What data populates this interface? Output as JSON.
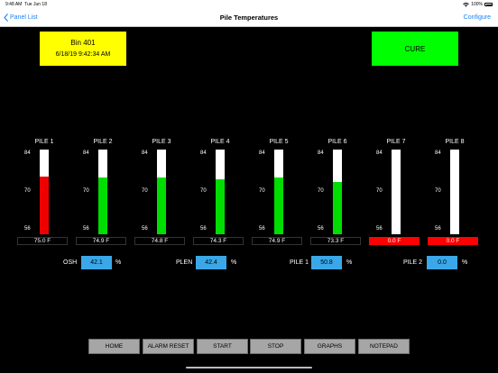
{
  "status_bar": {
    "time": "9:48 AM",
    "date": "Tue Jun 18",
    "battery": "100%"
  },
  "nav": {
    "back_label": "Panel List",
    "title": "Pile Temperatures",
    "configure_label": "Configure"
  },
  "bin": {
    "name": "Bin 401",
    "datetime": "6/18/19  9:42:34 AM"
  },
  "mode_label": "CURE",
  "colors": {
    "bin_box": "#ffff00",
    "mode_box": "#00ff00",
    "alarm": "#ff0000",
    "normal_fill": "#00dd00",
    "param_box": "#3aa8e8"
  },
  "scale": {
    "min": 56,
    "max": 84,
    "ticks": [
      "84",
      "70",
      "56"
    ]
  },
  "piles": [
    {
      "label": "PILE 1",
      "reading": "75.0 F",
      "level": 75.0,
      "alarm": false,
      "fill_color": "#ee0000"
    },
    {
      "label": "PILE 2",
      "reading": "74.9 F",
      "level": 74.9,
      "alarm": false,
      "fill_color": "#00dd00"
    },
    {
      "label": "PILE 3",
      "reading": "74.8 F",
      "level": 74.8,
      "alarm": false,
      "fill_color": "#00dd00"
    },
    {
      "label": "PILE 4",
      "reading": "74.3 F",
      "level": 74.3,
      "alarm": false,
      "fill_color": "#00dd00"
    },
    {
      "label": "PILE 5",
      "reading": "74.9 F",
      "level": 74.9,
      "alarm": false,
      "fill_color": "#00dd00"
    },
    {
      "label": "PILE 6",
      "reading": "73.3 F",
      "level": 73.3,
      "alarm": false,
      "fill_color": "#00dd00"
    },
    {
      "label": "PILE 7",
      "reading": "0.0 F",
      "level": 0.0,
      "alarm": true,
      "fill_color": "#00dd00"
    },
    {
      "label": "PILE 8",
      "reading": "0.0 F",
      "level": 0.0,
      "alarm": true,
      "fill_color": "#00dd00"
    }
  ],
  "params": [
    {
      "label": "OSH",
      "value": "42.1",
      "unit": "%"
    },
    {
      "label": "PLEN",
      "value": "42.4",
      "unit": "%"
    },
    {
      "label": "PILE 1",
      "value": "50.8",
      "unit": "%"
    },
    {
      "label": "PILE 2",
      "value": "0.0",
      "unit": "%"
    }
  ],
  "buttons": [
    "HOME",
    "ALARM RESET",
    "START",
    "STOP",
    "GRAPHS",
    "NOTEPAD"
  ]
}
